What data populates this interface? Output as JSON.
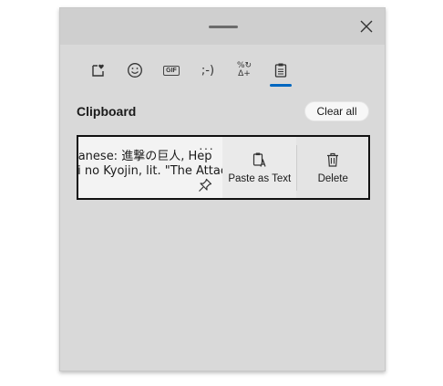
{
  "tabs": [
    {
      "name": "favorites-tab",
      "icon": "heart-sticker-icon"
    },
    {
      "name": "emoji-tab",
      "icon": "smiley-icon"
    },
    {
      "name": "gif-tab",
      "icon": "gif-icon",
      "label": "GIF"
    },
    {
      "name": "kaomoji-tab",
      "icon": "kaomoji-icon",
      "label": ";-)"
    },
    {
      "name": "symbols-tab",
      "icon": "symbols-icon",
      "label_top": "%↻",
      "label_bottom": "Δ+"
    },
    {
      "name": "clipboard-tab",
      "icon": "clipboard-icon",
      "selected": true
    }
  ],
  "section": {
    "title": "Clipboard",
    "clear_all_label": "Clear all"
  },
  "clipboard_item": {
    "line1": "Titan (Japanese: 進撃の巨人, Hep",
    "line2": "Shingeki no Kyojin, lit. \"The Attack Tita",
    "more_label": "···",
    "actions": {
      "paste_as_text": "Paste as Text",
      "delete": "Delete"
    }
  },
  "colors": {
    "accent": "#0067c0",
    "panel_bg": "#d9d9d9"
  }
}
